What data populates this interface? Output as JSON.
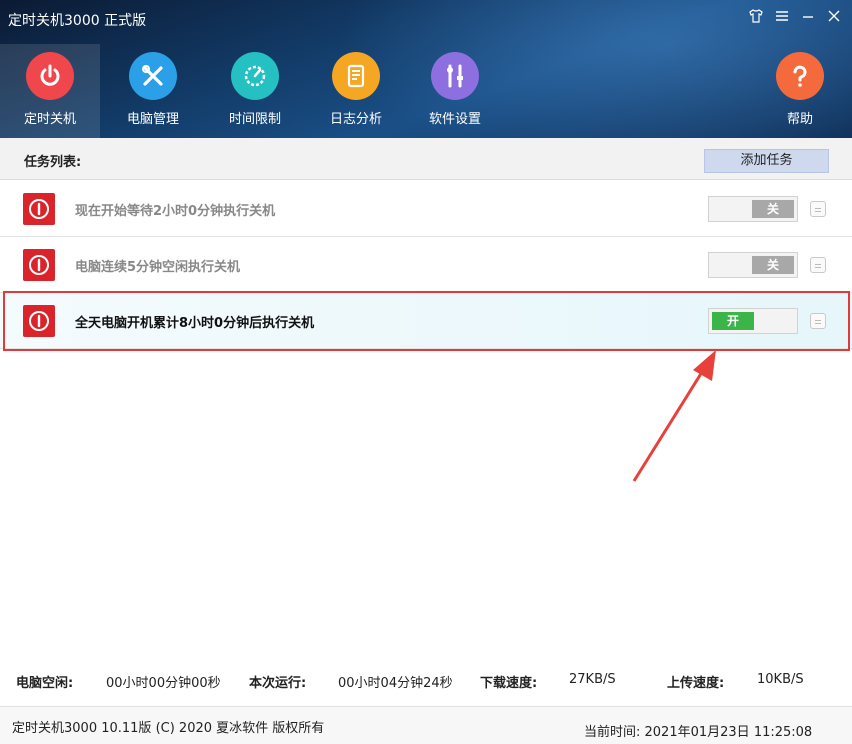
{
  "window": {
    "title": "定时关机3000 正式版"
  },
  "nav": [
    {
      "label": "定时关机",
      "icon": "power-icon",
      "color": "#f0474d"
    },
    {
      "label": "电脑管理",
      "icon": "tools-icon",
      "color": "#2ba0e8"
    },
    {
      "label": "时间限制",
      "icon": "timer-icon",
      "color": "#25c0c2"
    },
    {
      "label": "日志分析",
      "icon": "log-icon",
      "color": "#f5a623"
    },
    {
      "label": "软件设置",
      "icon": "wrench-icon",
      "color": "#8e6fe0"
    },
    {
      "label": "帮助",
      "icon": "help-icon",
      "color": "#f46a3c"
    }
  ],
  "tasks": {
    "header_title": "任务列表:",
    "add_button": "添加任务",
    "items": [
      {
        "text": "现在开始等待2小时0分钟执行关机",
        "toggle": "关",
        "state": "off"
      },
      {
        "text": "电脑连续5分钟空闲执行关机",
        "toggle": "关",
        "state": "off"
      },
      {
        "text": "全天电脑开机累计8小时0分钟后执行关机",
        "toggle": "开",
        "state": "on"
      }
    ]
  },
  "stats": {
    "idle_label": "电脑空闲:",
    "idle_value": "00小时00分钟00秒",
    "run_label": "本次运行:",
    "run_value": "00小时04分钟24秒",
    "down_label": "下载速度:",
    "down_value": "27KB/S",
    "up_label": "上传速度:",
    "up_value": "10KB/S"
  },
  "footer": {
    "copyright": "定时关机3000 10.11版 (C) 2020  夏冰软件 版权所有",
    "time": "当前时间: 2021年01月23日 11:25:08"
  }
}
